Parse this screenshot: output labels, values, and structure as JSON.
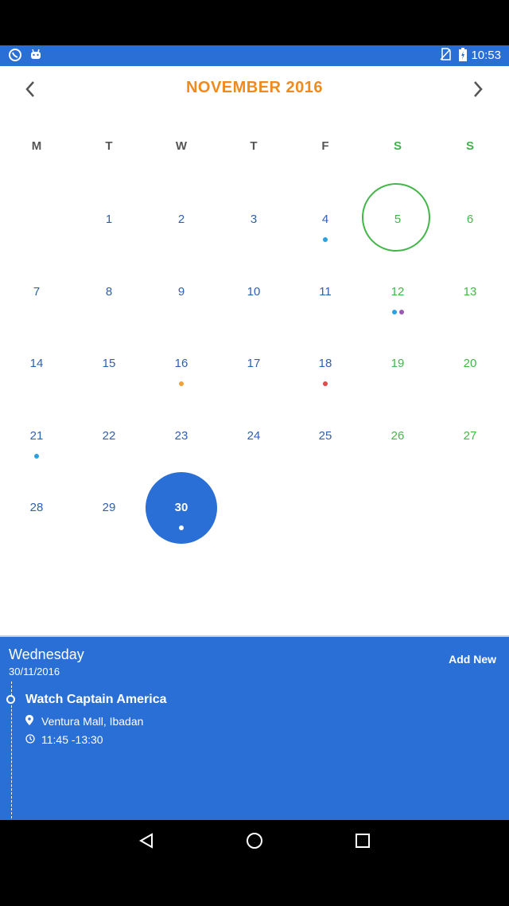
{
  "status_bar": {
    "time": "10:53",
    "left_icons": [
      "whatsapp-icon",
      "android-icon"
    ],
    "right_icons": [
      "no-sim-icon",
      "battery-charging-icon"
    ]
  },
  "calendar": {
    "month_title": "NOVEMBER 2016",
    "weekdays": [
      "M",
      "T",
      "W",
      "T",
      "F",
      "S",
      "S"
    ],
    "today": "5",
    "selected": "30",
    "rows": [
      [
        {
          "day": ""
        },
        {
          "day": "1"
        },
        {
          "day": "2"
        },
        {
          "day": "3"
        },
        {
          "day": "4",
          "dots": [
            "#2aa1e0"
          ]
        },
        {
          "day": "5"
        },
        {
          "day": "6"
        }
      ],
      [
        {
          "day": "7"
        },
        {
          "day": "8"
        },
        {
          "day": "9"
        },
        {
          "day": "10"
        },
        {
          "day": "11"
        },
        {
          "day": "12",
          "dots": [
            "#2aa1e0",
            "#9b59b6"
          ]
        },
        {
          "day": "13"
        }
      ],
      [
        {
          "day": "14"
        },
        {
          "day": "15"
        },
        {
          "day": "16",
          "dots": [
            "#f0a23a"
          ]
        },
        {
          "day": "17"
        },
        {
          "day": "18",
          "dots": [
            "#e04b4b"
          ]
        },
        {
          "day": "19"
        },
        {
          "day": "20"
        }
      ],
      [
        {
          "day": "21",
          "dots": [
            "#2aa1e0"
          ]
        },
        {
          "day": "22"
        },
        {
          "day": "23"
        },
        {
          "day": "24"
        },
        {
          "day": "25"
        },
        {
          "day": "26"
        },
        {
          "day": "27"
        }
      ],
      [
        {
          "day": "28"
        },
        {
          "day": "29"
        },
        {
          "day": "30",
          "dots": [
            "#ffffff"
          ]
        },
        {
          "day": ""
        },
        {
          "day": ""
        },
        {
          "day": ""
        },
        {
          "day": ""
        }
      ]
    ]
  },
  "panel": {
    "weekday": "Wednesday",
    "date": "30/11/2016",
    "add_new": "Add New",
    "event": {
      "title": "Watch Captain America",
      "location": "Ventura Mall, Ibadan",
      "time": "11:45 -13:30"
    }
  },
  "colors": {
    "primary": "#2a6fd6",
    "accent": "#f08a1c",
    "weekend": "#43b649",
    "day_text": "#2f5fb0"
  }
}
